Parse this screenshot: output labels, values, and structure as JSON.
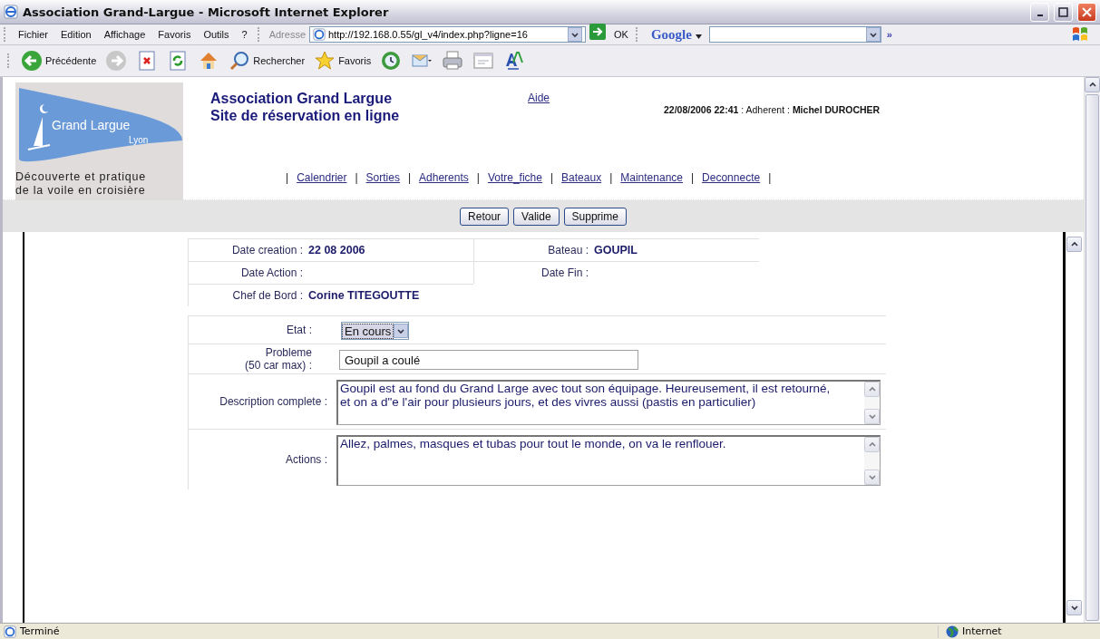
{
  "window": {
    "title": "Association Grand-Largue - Microsoft Internet Explorer"
  },
  "menu": [
    "Fichier",
    "Edition",
    "Affichage",
    "Favoris",
    "Outils",
    "?"
  ],
  "address": {
    "label": "Adresse",
    "value": "http://192.168.0.55/gl_v4/index.php?ligne=16",
    "go": "OK"
  },
  "google": {
    "label": "Google",
    "more": "»"
  },
  "toolbar": [
    {
      "kind": "back",
      "label": "Précédente"
    },
    {
      "kind": "forward"
    },
    {
      "kind": "stop"
    },
    {
      "kind": "refresh"
    },
    {
      "kind": "home"
    },
    {
      "kind": "search",
      "label": "Rechercher"
    },
    {
      "kind": "favorites",
      "label": "Favoris"
    },
    {
      "kind": "history"
    },
    {
      "kind": "mail"
    },
    {
      "kind": "print"
    },
    {
      "kind": "edit"
    },
    {
      "kind": "font"
    }
  ],
  "header": {
    "logo": {
      "name": "Grand Largue",
      "city": "Lyon"
    },
    "tagline": [
      "Découverte et pratique",
      "de la voile en croisière"
    ],
    "site_title": [
      "Association Grand Largue",
      "Site de réservation en ligne"
    ],
    "help": "Aide",
    "session": "**22/08/2006 22:41** : Adherent : **Michel DUROCHER**",
    "nav": [
      {
        "kind": "separator",
        "text": "|"
      },
      {
        "kind": "link",
        "text": "Calendrier"
      },
      {
        "kind": "separator",
        "text": "|"
      },
      {
        "kind": "link",
        "text": "Sorties"
      },
      {
        "kind": "separator",
        "text": "|"
      },
      {
        "kind": "link",
        "text": "Adherents"
      },
      {
        "kind": "separator",
        "text": "|"
      },
      {
        "kind": "link",
        "text": "Votre_fiche"
      },
      {
        "kind": "separator",
        "text": "|"
      },
      {
        "kind": "link",
        "text": "Bateaux"
      },
      {
        "kind": "separator",
        "text": "|"
      },
      {
        "kind": "link",
        "text": "Maintenance"
      },
      {
        "kind": "separator",
        "text": "|"
      },
      {
        "kind": "link",
        "text": "Deconnecte"
      },
      {
        "kind": "separator",
        "text": "|"
      }
    ]
  },
  "buttons": [
    "Retour",
    "Valide",
    "Supprime"
  ],
  "info": {
    "left": [
      {
        "label": "Date creation :",
        "value": "22 08 2006"
      },
      {
        "label": "Date Action :"
      },
      {
        "label": "Chef de Bord :",
        "value": "Corine TITEGOUTTE"
      }
    ],
    "right": [
      {
        "label": "Bateau :",
        "value": "GOUPIL"
      },
      {
        "label": "Date Fin :"
      }
    ]
  },
  "form": [
    {
      "kind": "select",
      "label": [
        "Etat :"
      ],
      "value": "En cours"
    },
    {
      "kind": "input",
      "label": [
        "Probleme",
        "(50 car max) :"
      ],
      "value": "Goupil a coulé"
    },
    {
      "kind": "textarea",
      "label": [
        "Description complete :"
      ],
      "value": "Goupil est au fond du Grand Large avec tout son équipage. Heureusement, il est retourné, et on a d\"e l'air pour plusieurs jours, et des vivres aussi (pastis en particulier)"
    },
    {
      "kind": "textarea",
      "label": [
        "Actions :"
      ],
      "value": "Allez, palmes, masques et tubas pour tout le monde, on va le renflouer."
    }
  ],
  "status_bar": {
    "text": "Terminé",
    "zone": "Internet"
  }
}
